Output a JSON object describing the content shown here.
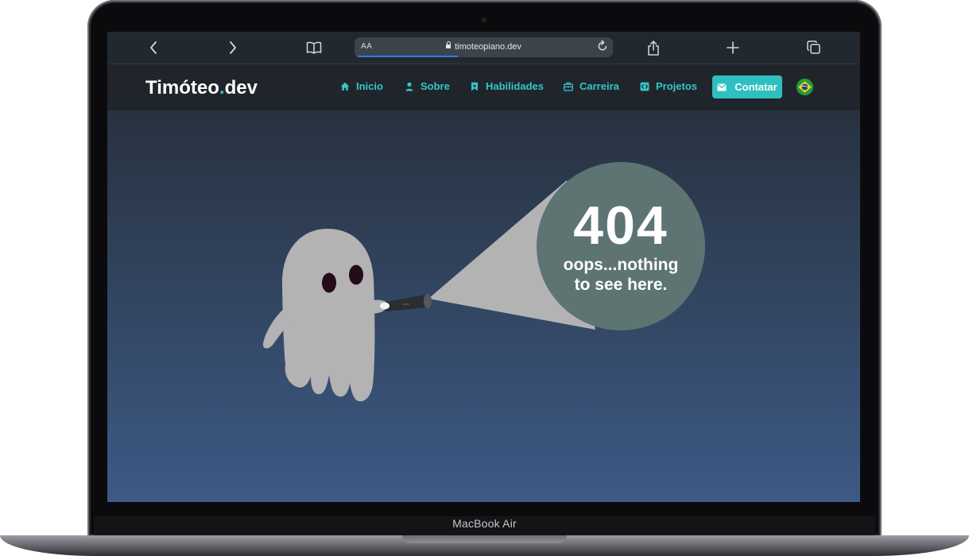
{
  "device": {
    "model_label": "MacBook Air"
  },
  "browser": {
    "text_size_label": "AA",
    "url": "timoteopiano.dev",
    "load_progress_percent": 40,
    "icons": [
      "back-icon",
      "forward-icon",
      "bookmarks-icon",
      "lock-icon",
      "reload-icon",
      "share-icon",
      "new-tab-icon",
      "tabs-icon"
    ]
  },
  "site": {
    "brand": {
      "name": "Timóteo",
      "dot": ".",
      "tld": "dev"
    },
    "nav": [
      {
        "label": "Inicio",
        "icon": "home-icon"
      },
      {
        "label": "Sobre",
        "icon": "user-icon"
      },
      {
        "label": "Habilidades",
        "icon": "bookmark-icon"
      },
      {
        "label": "Carreira",
        "icon": "briefcase-icon"
      },
      {
        "label": "Projetos",
        "icon": "code-icon"
      }
    ],
    "contact": {
      "label": "Contatar",
      "icon": "envelope-icon"
    },
    "language_flag": "brazil-flag-icon"
  },
  "error_page": {
    "code": "404",
    "message_line1": "oops...nothing",
    "message_line2": "to see here."
  },
  "colors": {
    "accent": "#2ec0c1",
    "nav_bg": "#20252c",
    "gradient_top": "#283240",
    "gradient_bottom": "#3d5a85",
    "bubble": "#5d7472",
    "ghost": "#b3b3b4"
  }
}
